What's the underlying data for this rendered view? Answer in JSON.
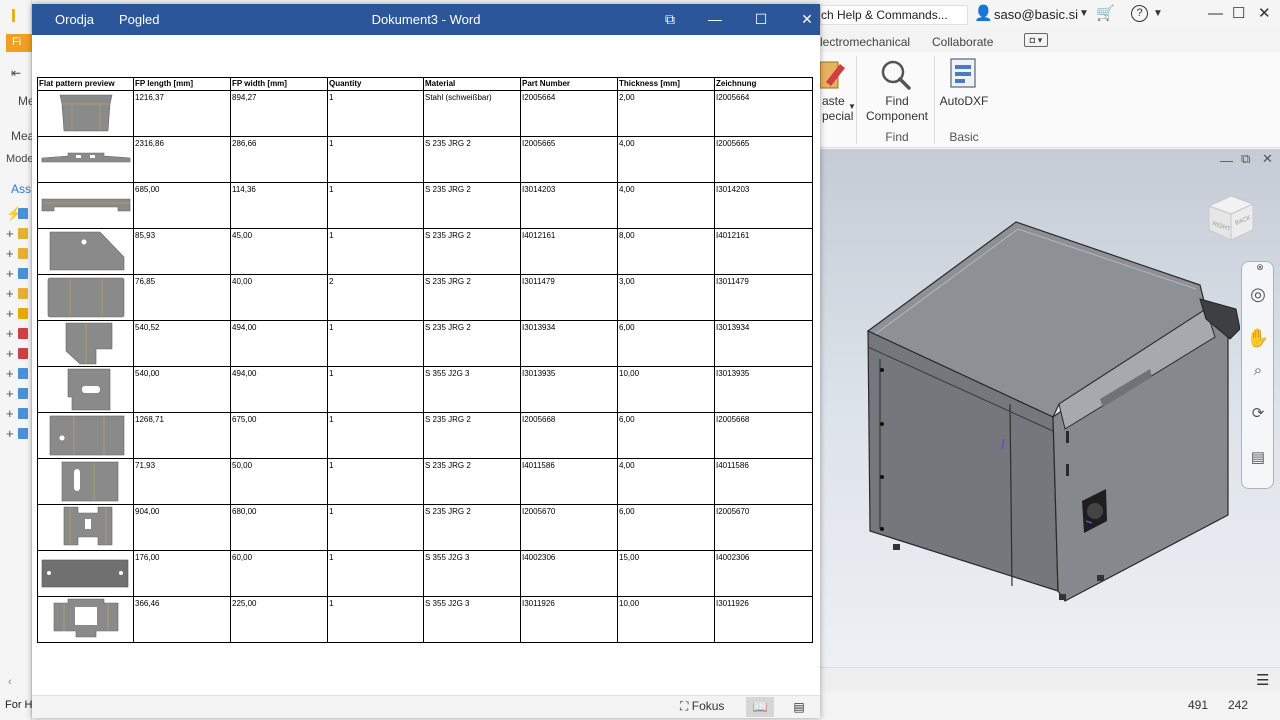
{
  "word": {
    "title": "Dokument3  -  Word",
    "menu": [
      "Orodja",
      "Pogled"
    ],
    "controls": {
      "restore_layout": "⧉",
      "minimize": "—",
      "maximize": "☐",
      "close": "✕"
    },
    "status": {
      "focus_label": "Fokus"
    }
  },
  "table": {
    "headers": [
      "Flat pattern preview",
      "FP length [mm]",
      "FP width [mm]",
      "Quantity",
      "Material",
      "Part Number",
      "Thickness [mm]",
      "Zeichnung"
    ],
    "rows": [
      {
        "fp_length": "1216,37",
        "fp_width": "894,27",
        "quantity": "1",
        "material": "Stahl (schweißbar)",
        "part_number": "I2005664",
        "thickness": "2,00",
        "drawing": "I2005664"
      },
      {
        "fp_length": "2316,86",
        "fp_width": "286,66",
        "quantity": "1",
        "material": "S 235 JRG 2",
        "part_number": "I2005665",
        "thickness": "4,00",
        "drawing": "I2005665"
      },
      {
        "fp_length": "685,00",
        "fp_width": "114,36",
        "quantity": "1",
        "material": "S 235 JRG 2",
        "part_number": "I3014203",
        "thickness": "4,00",
        "drawing": "I3014203"
      },
      {
        "fp_length": "85,93",
        "fp_width": "45,00",
        "quantity": "1",
        "material": "S 235 JRG 2",
        "part_number": "I4012161",
        "thickness": "8,00",
        "drawing": "I4012161"
      },
      {
        "fp_length": "76,85",
        "fp_width": "40,00",
        "quantity": "2",
        "material": "S 235 JRG 2",
        "part_number": "I3011479",
        "thickness": "3,00",
        "drawing": "I3011479"
      },
      {
        "fp_length": "540,52",
        "fp_width": "494,00",
        "quantity": "1",
        "material": "S 235 JRG 2",
        "part_number": "I3013934",
        "thickness": "6,00",
        "drawing": "I3013934"
      },
      {
        "fp_length": "540,00",
        "fp_width": "494,00",
        "quantity": "1",
        "material": "S 355 J2G 3",
        "part_number": "I3013935",
        "thickness": "10,00",
        "drawing": "I3013935"
      },
      {
        "fp_length": "1268,71",
        "fp_width": "675,00",
        "quantity": "1",
        "material": "S 235 JRG 2",
        "part_number": "I2005668",
        "thickness": "6,00",
        "drawing": "I2005668"
      },
      {
        "fp_length": "71,93",
        "fp_width": "50,00",
        "quantity": "1",
        "material": "S 235 JRG 2",
        "part_number": "I4011586",
        "thickness": "4,00",
        "drawing": "I4011586"
      },
      {
        "fp_length": "904,00",
        "fp_width": "680,00",
        "quantity": "1",
        "material": "S 235 JRG 2",
        "part_number": "I2005670",
        "thickness": "6,00",
        "drawing": "I2005670"
      },
      {
        "fp_length": "176,00",
        "fp_width": "60,00",
        "quantity": "1",
        "material": "S 355 J2G 3",
        "part_number": "I4002306",
        "thickness": "15,00",
        "drawing": "I4002306"
      },
      {
        "fp_length": "366,46",
        "fp_width": "225,00",
        "quantity": "1",
        "material": "S 355 J2G 3",
        "part_number": "I3011926",
        "thickness": "10,00",
        "drawing": "I3011926"
      }
    ]
  },
  "inventor": {
    "search_text": "ch Help & Commands...",
    "user": "saso@basic.si",
    "help_icon": "?",
    "tabs": [
      "lectromechanical",
      "Collaborate"
    ],
    "ribbon": {
      "paste_special": [
        "aste",
        "pecial"
      ],
      "find_component": [
        "Find",
        "Component"
      ],
      "find_group": "Find",
      "autodxf": "AutoDXF",
      "basic_group": "Basic"
    },
    "left_fragments": [
      "Fi",
      "Me",
      "Mea",
      "Mode",
      "Ass"
    ],
    "status_text": "For H",
    "coords": [
      "491",
      "242"
    ]
  },
  "colors": {
    "word_blue": "#2b579a",
    "inventor_orange": "#f0a020",
    "viewport_top": "#c6ccd6",
    "part_gray": "#8a8a8a"
  }
}
